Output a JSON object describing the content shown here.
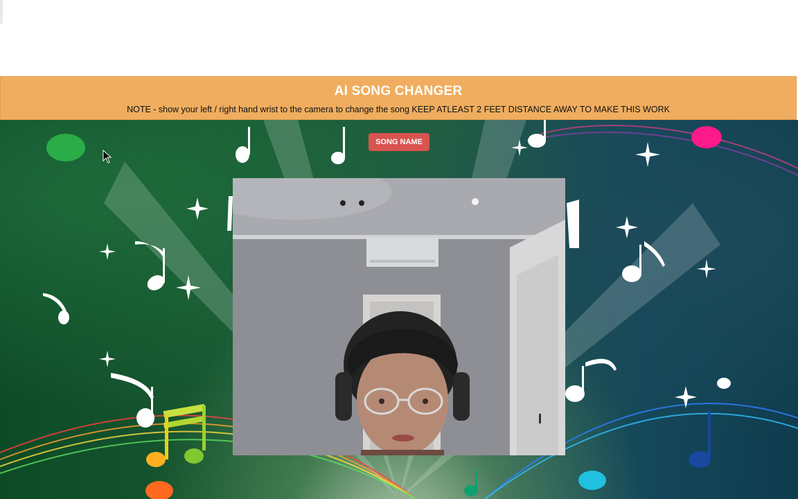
{
  "banner": {
    "title": "AI SONG CHANGER",
    "note": "NOTE - show your left / right hand wrist to the camera to change the song KEEP ATLEAST 2 FEET DISTANCE AWAY TO MAKE THIS WORK"
  },
  "controls": {
    "song_button_label": "SONG NAME"
  },
  "colors": {
    "banner_bg": "#f0ad5f",
    "button_bg": "#d9534f",
    "background_main": "#1a5a34"
  },
  "icons": {
    "background": "music-notes-background",
    "cursor": "mouse-pointer-icon"
  }
}
